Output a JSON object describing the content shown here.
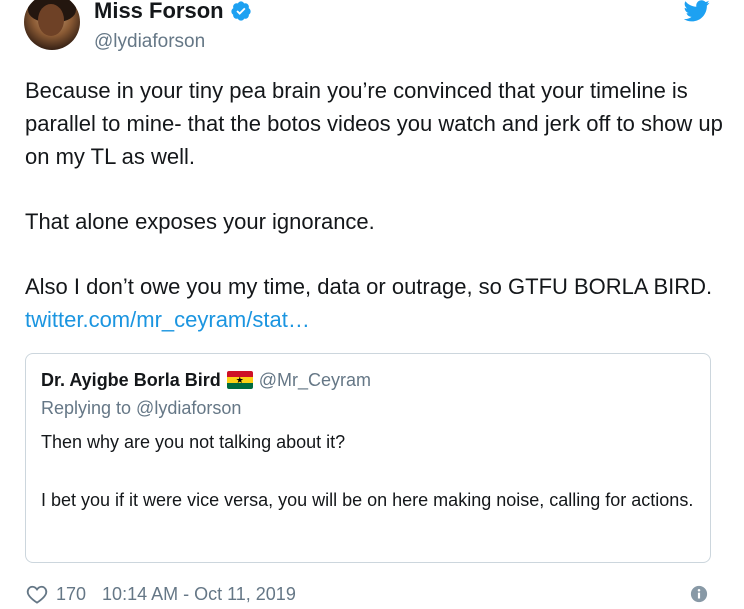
{
  "author": {
    "display_name": "Miss Forson",
    "handle": "@lydiaforson",
    "verified": true,
    "avatar_icon": "profile-photo"
  },
  "tweet": {
    "paragraphs": [
      "Because in your tiny pea brain you’re convinced that your timeline is parallel to mine- that the botos videos you watch and jerk off to show up on my TL as well.",
      "That alone exposes your ignorance."
    ],
    "last_paragraph_text": "Also I don’t owe you my time, data or outrage, so GTFU BORLA BIRD.",
    "link_text": "twitter.com/mr_ceyram/stat…"
  },
  "quoted": {
    "name": "Dr. Ayigbe Borla Bird",
    "flag_icon": "ghana-flag-icon",
    "handle": "@Mr_Ceyram",
    "replying_to": "Replying to @lydiaforson",
    "paragraphs": [
      "Then why are you not talking about it?",
      "I bet you if it were vice versa, you will be on here making noise, calling for actions."
    ]
  },
  "footer": {
    "like_count": "170",
    "timestamp": "10:14 AM - Oct 11, 2019"
  },
  "colors": {
    "link": "#1b95e0",
    "verified": "#1da1f2",
    "twitter_brand": "#1da1f2",
    "muted": "#657786",
    "border": "#ccd6dd"
  }
}
